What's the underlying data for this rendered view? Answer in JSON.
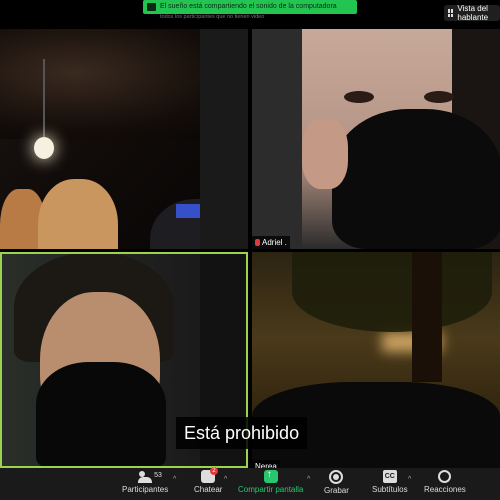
{
  "banner": {
    "text": "El sueño está compartiendo el sonido de la computadora",
    "subtext": "todos los participantes que no tienen video"
  },
  "view_button": {
    "label": "Vista del hablante"
  },
  "tiles": [
    {
      "name": ""
    },
    {
      "name": "Adriel ."
    },
    {
      "name": ""
    },
    {
      "name": "Nerea"
    }
  ],
  "subtitle": "Está prohibido",
  "toolbar": {
    "participants": {
      "label": "Participantes",
      "count": "53"
    },
    "chat": {
      "label": "Chatear",
      "badge": "2"
    },
    "share": {
      "label": "Compartir pantalla"
    },
    "record": {
      "label": "Grabar"
    },
    "captions": {
      "label": "Subtítulos",
      "icon_text": "CC"
    },
    "reactions": {
      "label": "Reacciones"
    }
  },
  "colors": {
    "share_green": "#28c76f",
    "banner_green": "#23c552",
    "active_speaker": "#9bd34f",
    "badge_red": "#e0393e"
  }
}
